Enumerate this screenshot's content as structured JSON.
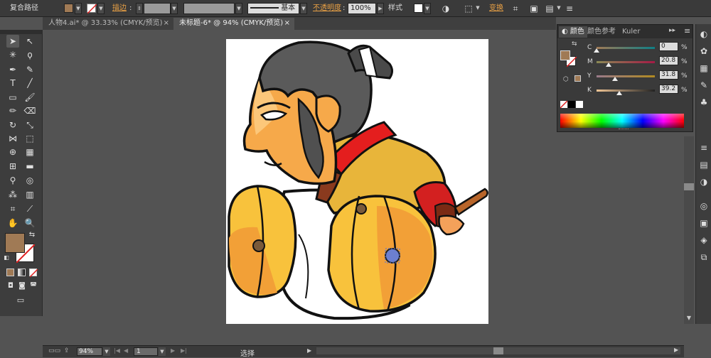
{
  "control_bar": {
    "selection_type": "复合路径",
    "stroke_label": "描边",
    "stroke_profile": "基本",
    "opacity_label": "不透明度",
    "opacity_value": "100%",
    "style_label": "样式",
    "transform_label": "变换",
    "fill_color": "#a07a55"
  },
  "tabs": [
    {
      "label": "人物4.ai* @ 33.33% (CMYK/预览)",
      "close": "×"
    },
    {
      "label": "未标题-6* @ 94% (CMYK/预览)",
      "close": "×"
    }
  ],
  "color_panel": {
    "tabs": [
      "颜色",
      "颜色参考",
      "Kuler"
    ],
    "sliders": [
      {
        "label": "C",
        "value": "0",
        "fraction": 0.0
      },
      {
        "label": "M",
        "value": "20.8",
        "fraction": 0.208
      },
      {
        "label": "Y",
        "value": "31.8",
        "fraction": 0.318
      },
      {
        "label": "K",
        "value": "39.2",
        "fraction": 0.392
      }
    ],
    "percent_sign": "%",
    "fill_swatch": "#a07a55"
  },
  "status_bar": {
    "zoom": "94%",
    "page": "1",
    "tool_status": "选择"
  },
  "colors": {
    "fill": "#a07a55",
    "accent_orange": "#e8a045"
  }
}
